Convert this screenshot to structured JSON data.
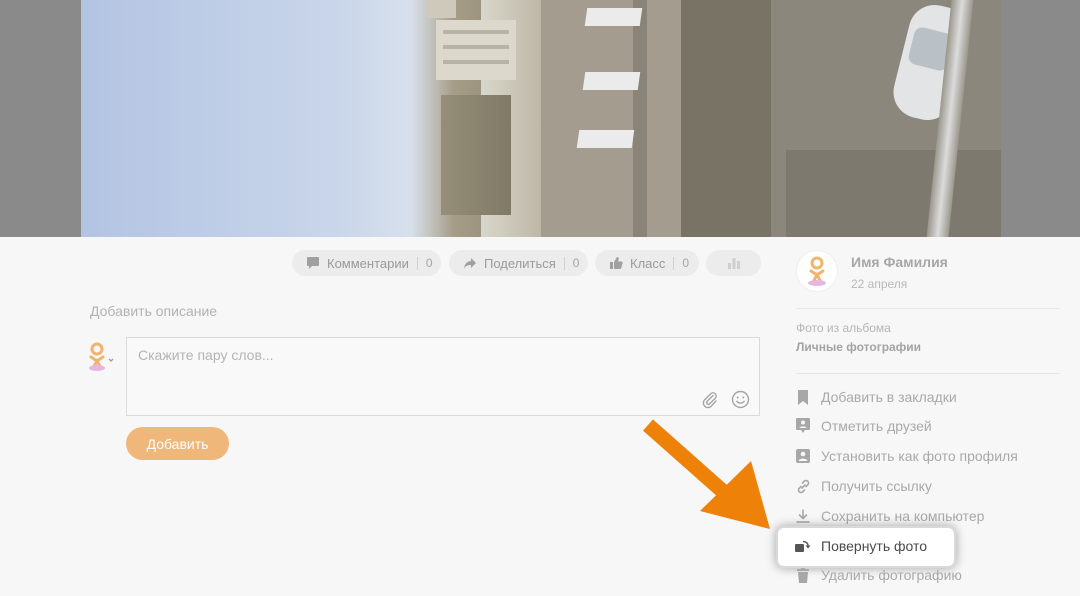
{
  "toolbar": {
    "comments_label": "Комментарии",
    "comments_count": "0",
    "share_label": "Поделиться",
    "share_count": "0",
    "class_label": "Класс",
    "class_count": "0"
  },
  "description_link": "Добавить описание",
  "comment": {
    "placeholder": "Скажите пару слов...",
    "submit_label": "Добавить"
  },
  "author": {
    "name": "Имя Фамилия",
    "date": "22 апреля"
  },
  "album": {
    "label": "Фото из альбома",
    "name": "Личные фотографии"
  },
  "menu": {
    "bookmark": "Добавить в закладки",
    "tag_friends": "Отметить друзей",
    "set_profile": "Установить как фото профиля",
    "get_link": "Получить ссылку",
    "save": "Сохранить на компьютер",
    "rotate": "Повернуть фото",
    "delete": "Удалить фотографию"
  },
  "colors": {
    "accent_orange": "#ee8208",
    "button_orange": "#f0b77a",
    "overlay_gray": "#8a8a8a"
  }
}
